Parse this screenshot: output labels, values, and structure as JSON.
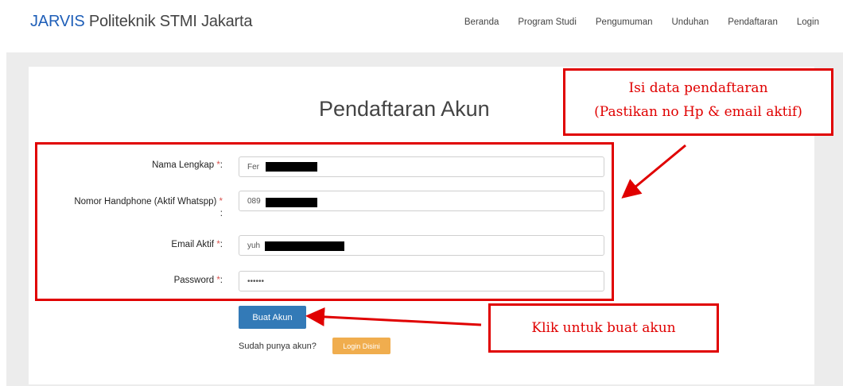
{
  "navbar": {
    "brand_highlight": "JARVIS",
    "brand_rest": " Politeknik STMI Jakarta",
    "items": [
      "Beranda",
      "Program Studi",
      "Pengumuman",
      "Unduhan",
      "Pendaftaran",
      "Login"
    ]
  },
  "form": {
    "title": "Pendaftaran Akun",
    "fields": [
      {
        "label": "Nama Lengkap",
        "value": "Fer"
      },
      {
        "label": "Nomor Handphone (Aktif Whatspp)",
        "value": "089"
      },
      {
        "label": "Email Aktif",
        "value": "yuh"
      },
      {
        "label": "Password",
        "value": "••••••"
      }
    ],
    "required_mark": "*",
    "colon": ":",
    "submit_label": "Buat Akun",
    "have_account_text": "Sudah punya akun?",
    "login_button_label": "Login Disini"
  },
  "annotations": {
    "fill_note_line1": "Isi data pendaftaran",
    "fill_note_line2": "(Pastikan no Hp & email aktif)",
    "click_note": "Klik untuk buat akun",
    "color": "#e00000"
  },
  "colors": {
    "brand_blue": "#1f5fb8",
    "primary_button": "#337ab7",
    "warning_button": "#f0ad4e",
    "required": "#d9534f"
  }
}
